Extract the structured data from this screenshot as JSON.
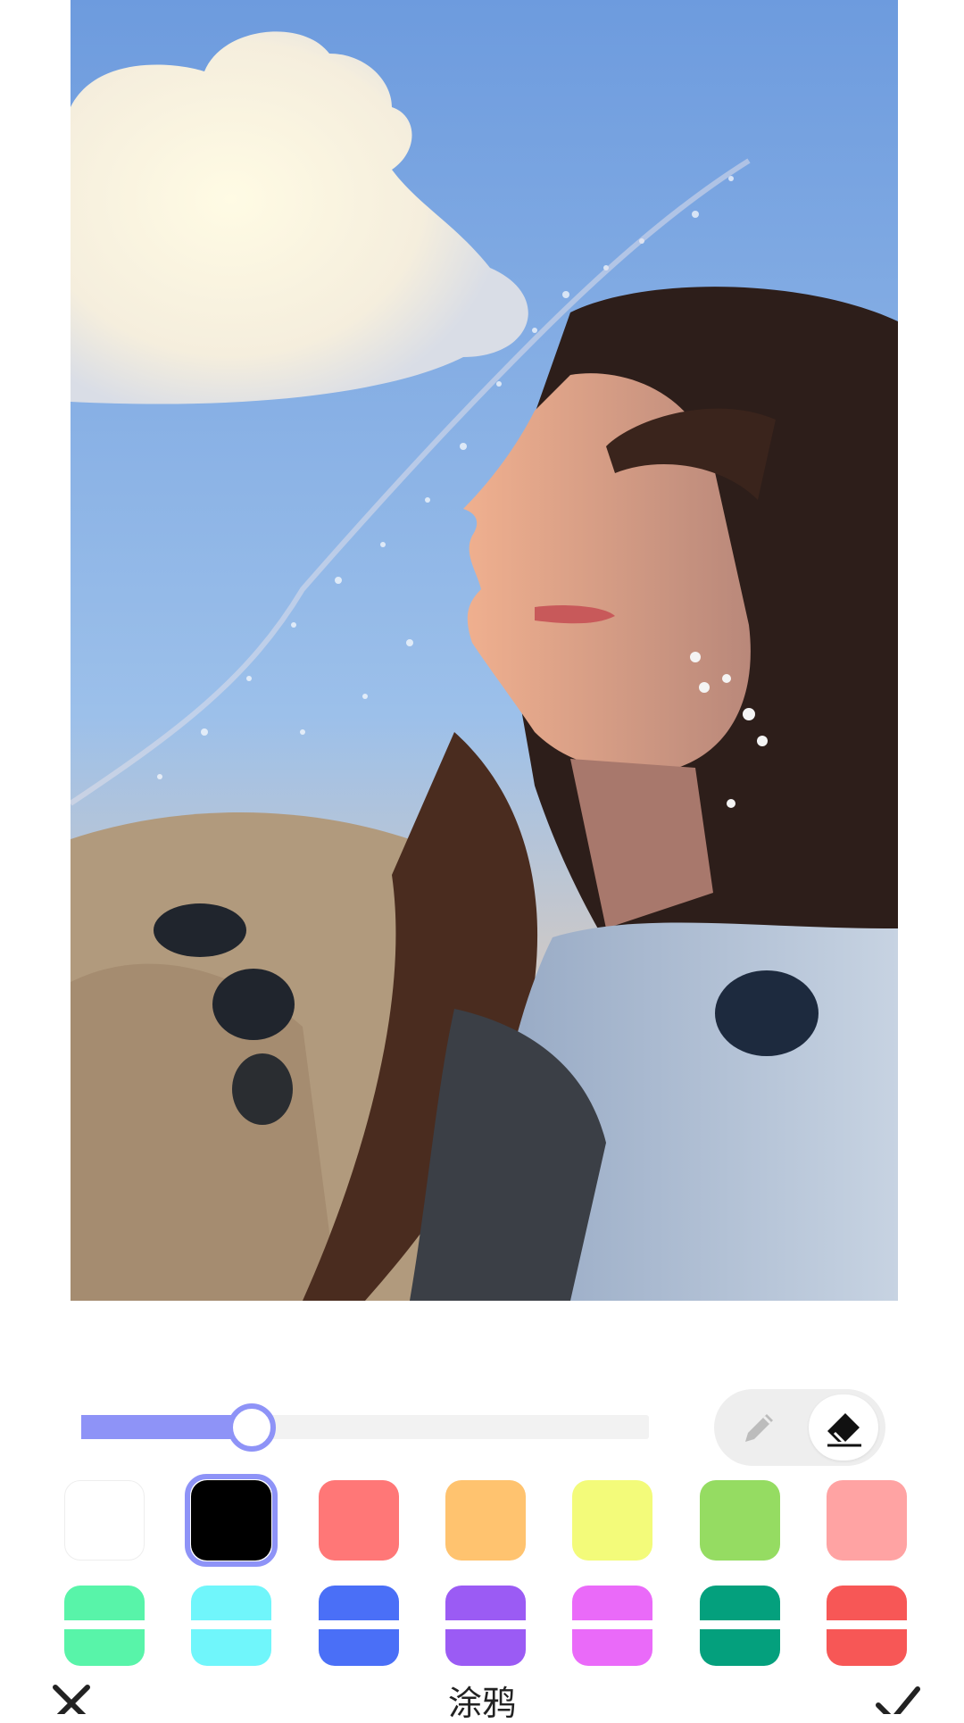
{
  "editor": {
    "title": "涂鸦",
    "brush_size_fraction": 0.3,
    "active_tool": "eraser"
  },
  "tools": [
    {
      "name": "pen-icon",
      "active": false
    },
    {
      "name": "eraser-icon",
      "active": true
    }
  ],
  "colors": {
    "accent": "#8e93f7",
    "palette_row_1": [
      "#ffffff",
      "#000000",
      "#ff7777",
      "#ffc36f",
      "#f3fb7a",
      "#95dc62",
      "#ffa3a3"
    ],
    "palette_row_2": [
      "#58f4a9",
      "#70f6fb",
      "#4a6ff7",
      "#9b5bf4",
      "#ea6af9",
      "#04a07d",
      "#f75756"
    ],
    "selected_color": "#000000"
  },
  "bottom_bar": {
    "close_icon": "close-icon",
    "confirm_icon": "check-icon"
  }
}
